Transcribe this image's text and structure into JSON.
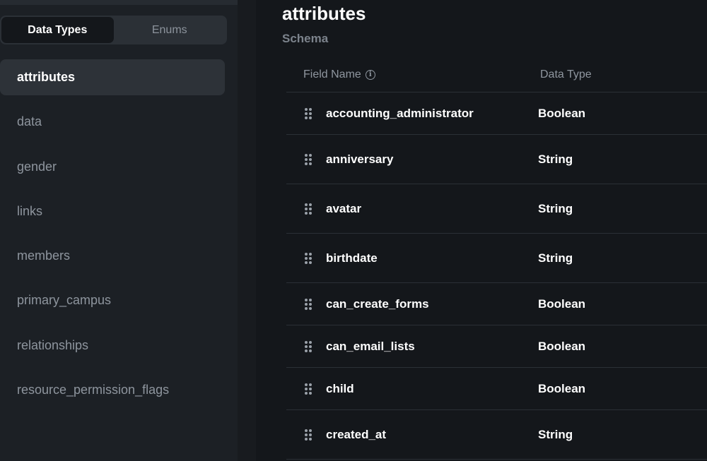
{
  "tabs": [
    {
      "label": "Data Types",
      "active": true
    },
    {
      "label": "Enums",
      "active": false
    }
  ],
  "types": [
    {
      "label": "attributes",
      "active": true
    },
    {
      "label": "data",
      "active": false
    },
    {
      "label": "gender",
      "active": false
    },
    {
      "label": "links",
      "active": false
    },
    {
      "label": "members",
      "active": false
    },
    {
      "label": "primary_campus",
      "active": false
    },
    {
      "label": "relationships",
      "active": false
    },
    {
      "label": "resource_permission_flags",
      "active": false
    }
  ],
  "main": {
    "title": "attributes",
    "subtitle": "Schema",
    "columns": {
      "field_name": "Field Name",
      "data_type": "Data Type",
      "info_icon": "i"
    },
    "rows": [
      {
        "field": "accounting_administrator",
        "type": "Boolean"
      },
      {
        "field": "anniversary",
        "type": "String"
      },
      {
        "field": "avatar",
        "type": "String"
      },
      {
        "field": "birthdate",
        "type": "String"
      },
      {
        "field": "can_create_forms",
        "type": "Boolean"
      },
      {
        "field": "can_email_lists",
        "type": "Boolean"
      },
      {
        "field": "child",
        "type": "Boolean"
      },
      {
        "field": "created_at",
        "type": "String"
      }
    ]
  },
  "colors": {
    "background": "#14171b",
    "sidebar": "#1c2025",
    "active_item": "#2d3238",
    "text_primary": "#ffffff",
    "text_muted": "#8e959e"
  }
}
